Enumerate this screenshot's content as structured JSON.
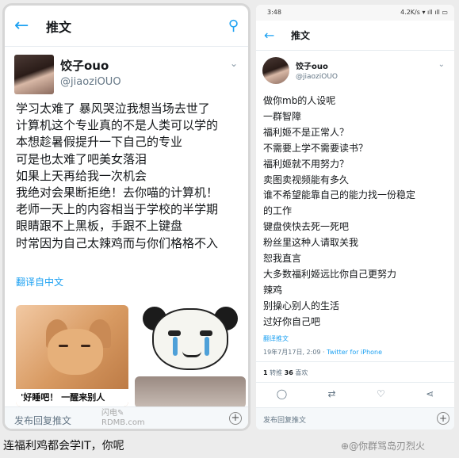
{
  "left": {
    "header_title": "推文",
    "user_name": "饺子ouo",
    "user_handle": "@jiaoziOUO",
    "tweet_lines": [
      "学习太难了 暴风哭泣我想当场去世了",
      "计算机这个专业真的不是人类可以学的",
      "本想趁暑假提升一下自己的专业",
      "可是也太难了吧美女落泪",
      "如果上天再给我一次机会",
      "我绝对会果断拒绝！去你喵的计算机！",
      "老师一天上的内容相当于学校的半学期",
      "眼睛跟不上黑板，手跟不上键盘",
      "时常因为自己太辣鸡而与你们格格不入"
    ],
    "translate_label": "翻译自中文",
    "meme_caption": "'好睡吧！ 一醒来别人",
    "reply_placeholder": "发布回复推文",
    "watermark": "闪电✎\nRDMB.com"
  },
  "right": {
    "status_time": "3:48",
    "status_icons": "4.2K/s ▾ ıll ıll ▭",
    "header_title": "推文",
    "user_name": "饺子ouo",
    "user_handle": "@jiaoziOUO",
    "tweet_lines": [
      "做你mb的人设呢",
      "一群智障",
      "福利姬不是正常人？",
      "不需要上学不需要读书？",
      "福利姬就不用努力？",
      "卖图卖视频能有多久",
      "谁不希望能靠自己的能力找一份稳定",
      "的工作",
      "键盘侠快去死一死吧",
      "粉丝里这种人请取关我",
      "恕我直言",
      "大多数福利姬远比你自己更努力",
      "辣鸡",
      "别操心别人的生活",
      "过好你自己吧"
    ],
    "translate_label": "翻译推文",
    "timestamp": "19年7月17日, 2:09 · ",
    "source": "Twitter for iPhone",
    "retweets_count": "1",
    "retweets_label": " 转推  ",
    "likes_count": "36",
    "likes_label": " 喜欢",
    "reply_placeholder": "发布回复推文"
  },
  "caption": "连福利鸡都会学IT，你呢",
  "weibo_watermark": "⊕@你群骂岛刃烈火"
}
